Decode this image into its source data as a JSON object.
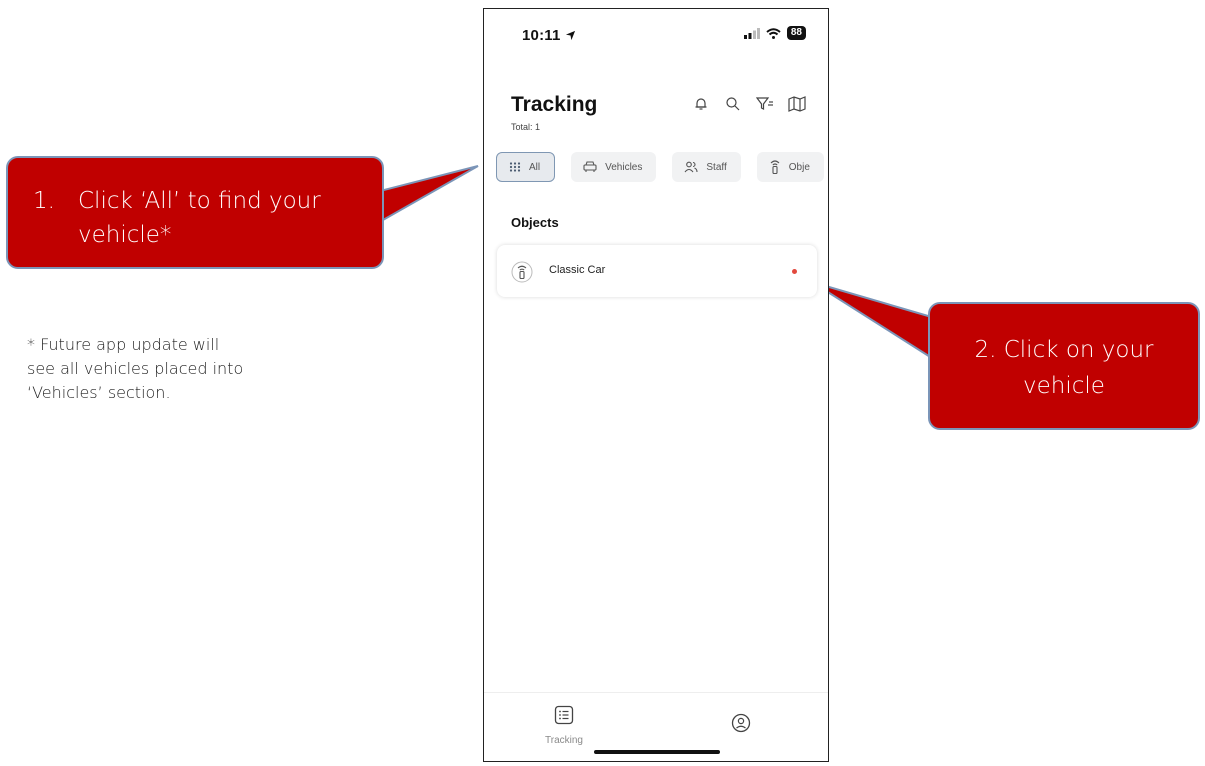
{
  "status_bar": {
    "time": "10:11",
    "battery": "88"
  },
  "header": {
    "title": "Tracking",
    "total": "Total: 1"
  },
  "header_icons": [
    "bell-icon",
    "search-icon",
    "filter-icon",
    "map-icon"
  ],
  "filter_chips": [
    {
      "label": "All",
      "icon": "grid-icon",
      "active": true
    },
    {
      "label": "Vehicles",
      "icon": "car-icon",
      "active": false
    },
    {
      "label": "Staff",
      "icon": "people-icon",
      "active": false
    },
    {
      "label": "Obje",
      "icon": "tracker-icon",
      "active": false
    }
  ],
  "section": {
    "title": "Objects"
  },
  "objects": [
    {
      "name": "Classic Car",
      "icon": "tracker-icon",
      "status_color": "#e2483d"
    }
  ],
  "tab_bar": {
    "tracking_label": "Tracking",
    "tracking_icon": "list-icon",
    "profile_icon": "profile-icon"
  },
  "callouts": {
    "step1_number": "1.",
    "step1_line1": "Click ‘All’ to find your",
    "step1_line2": "vehicle*",
    "step2_line1": "2. Click on your",
    "step2_line2": "vehicle"
  },
  "footnote": {
    "line1": "* Future app update will",
    "line2": "see all vehicles placed into",
    "line3": "‘Vehicles’ section."
  },
  "colors": {
    "callout_fill": "#c00000",
    "callout_border": "#7b95b8",
    "chip_active_border": "#7f97b3"
  }
}
